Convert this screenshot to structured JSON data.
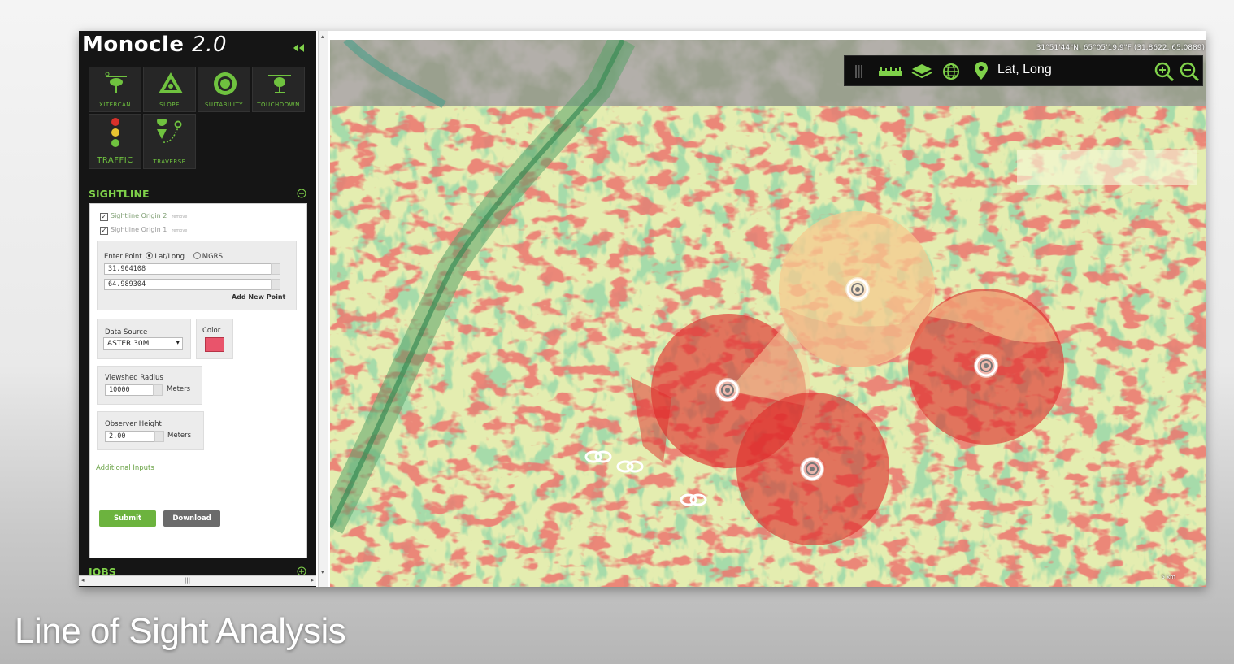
{
  "app": {
    "title_main": "Monocle",
    "title_version": "2.0"
  },
  "tools": [
    {
      "label": "XITERCAN",
      "icon": "helicopter-tracker-icon"
    },
    {
      "label": "SLOPE",
      "icon": "slope-triangle-icon"
    },
    {
      "label": "SUITABILITY",
      "icon": "suitability-ring-icon"
    },
    {
      "label": "TOUCHDOWN",
      "icon": "helicopter-icon"
    },
    {
      "label": "TRAFFIC",
      "icon": "traffic-light-icon"
    },
    {
      "label": "TRAVERSE",
      "icon": "traverse-pins-icon"
    }
  ],
  "sightline": {
    "heading": "SIGHTLINE",
    "layers": [
      {
        "label": "Sightline Origin 2",
        "checked": true,
        "sub": "remove"
      },
      {
        "label": "Sightline Origin 1",
        "checked": true,
        "sub": "remove"
      }
    ],
    "enter_point_label": "Enter Point",
    "mode_latlong": "Lat/Long",
    "mode_mgrs": "MGRS",
    "lat_value": "31.904108",
    "lon_value": "64.989304",
    "add_new_point": "Add New Point",
    "data_source_label": "Data Source",
    "data_source_value": "ASTER 30M",
    "color_label": "Color",
    "color_value": "#e9546b",
    "viewshed_label": "Viewshed Radius",
    "viewshed_value": "10000",
    "viewshed_unit": "Meters",
    "observer_label": "Observer Height",
    "observer_value": "2.00",
    "observer_unit": "Meters",
    "additional_inputs": "Additional Inputs",
    "submit_label": "Submit",
    "download_label": "Download"
  },
  "jobs": {
    "heading": "JOBS"
  },
  "map": {
    "coords_readout": "31°51'44\"N, 65°05'19.9\"F (31.8622, 65.0889)",
    "latlong_label": "Lat, Long",
    "scale_label": "5 km"
  },
  "caption": "Line of Sight Analysis",
  "colors": {
    "accent_green": "#7fd14a",
    "submit_green": "#6cb33e",
    "download_grey": "#6b6b6b",
    "viewshed_red": "#e02020",
    "viewshed_orange": "#f2b27a"
  }
}
